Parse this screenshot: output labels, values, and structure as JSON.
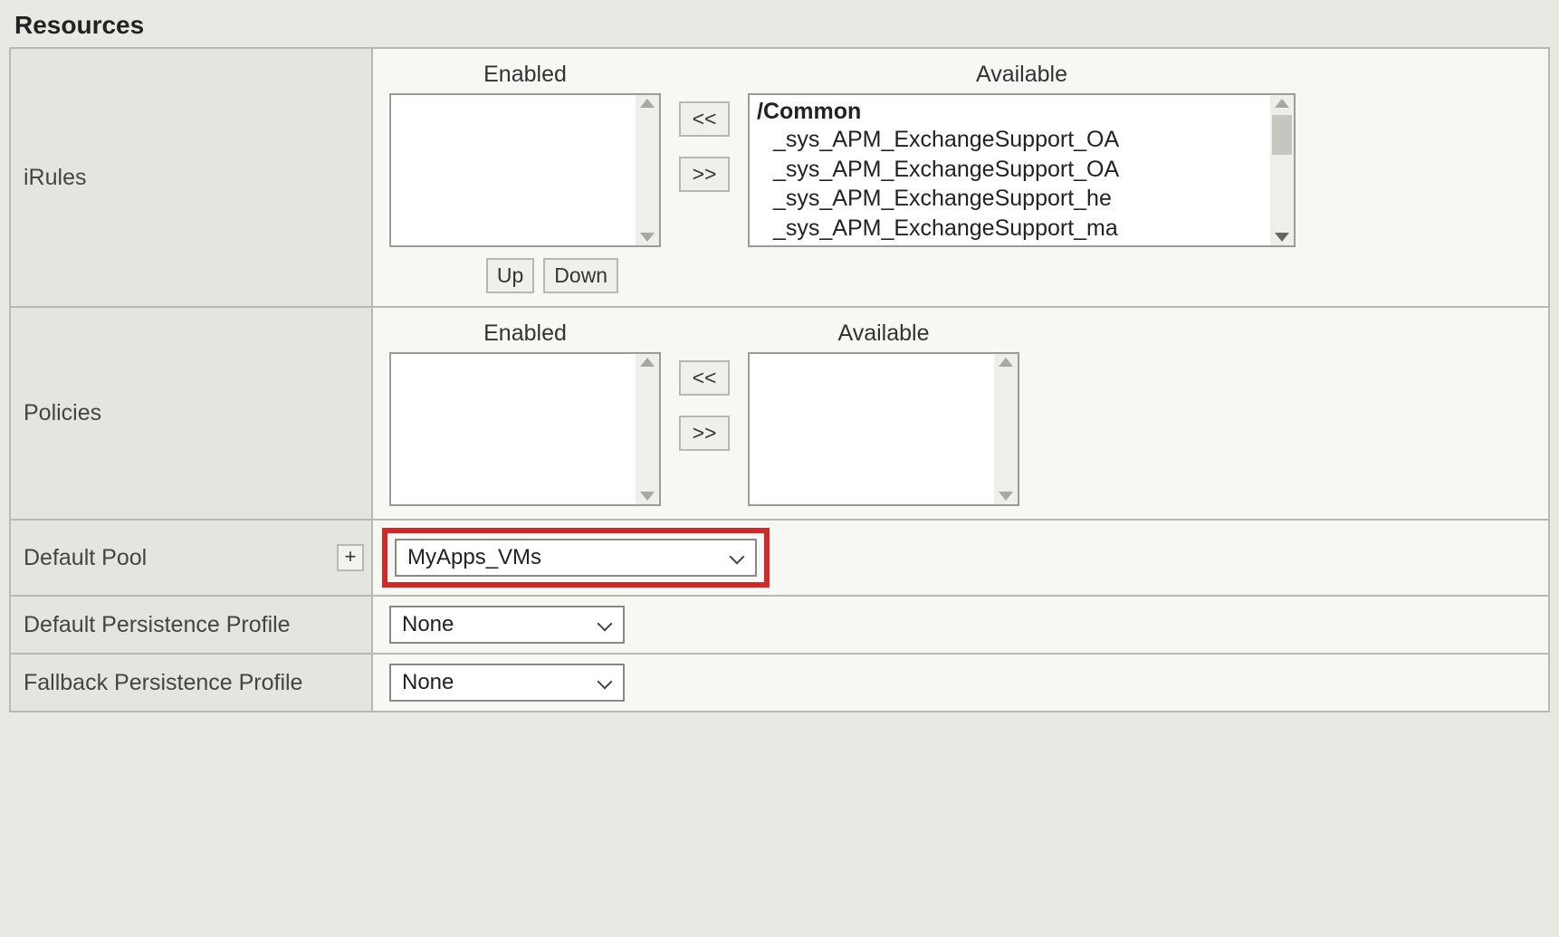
{
  "section_title": "Resources",
  "labels": {
    "irules": "iRules",
    "policies": "Policies",
    "default_pool": "Default Pool",
    "default_persistence": "Default Persistence Profile",
    "fallback_persistence": "Fallback Persistence Profile"
  },
  "headers": {
    "enabled": "Enabled",
    "available": "Available"
  },
  "buttons": {
    "move_left": "<<",
    "move_right": ">>",
    "up": "Up",
    "down": "Down",
    "plus": "+"
  },
  "irules": {
    "enabled": [],
    "available_group": "/Common",
    "available": [
      "_sys_APM_ExchangeSupport_OA",
      "_sys_APM_ExchangeSupport_OA",
      "_sys_APM_ExchangeSupport_he",
      "_sys_APM_ExchangeSupport_ma"
    ]
  },
  "policies": {
    "enabled": [],
    "available": []
  },
  "default_pool": {
    "selected": "MyApps_VMs"
  },
  "default_persistence": {
    "selected": "None"
  },
  "fallback_persistence": {
    "selected": "None"
  }
}
